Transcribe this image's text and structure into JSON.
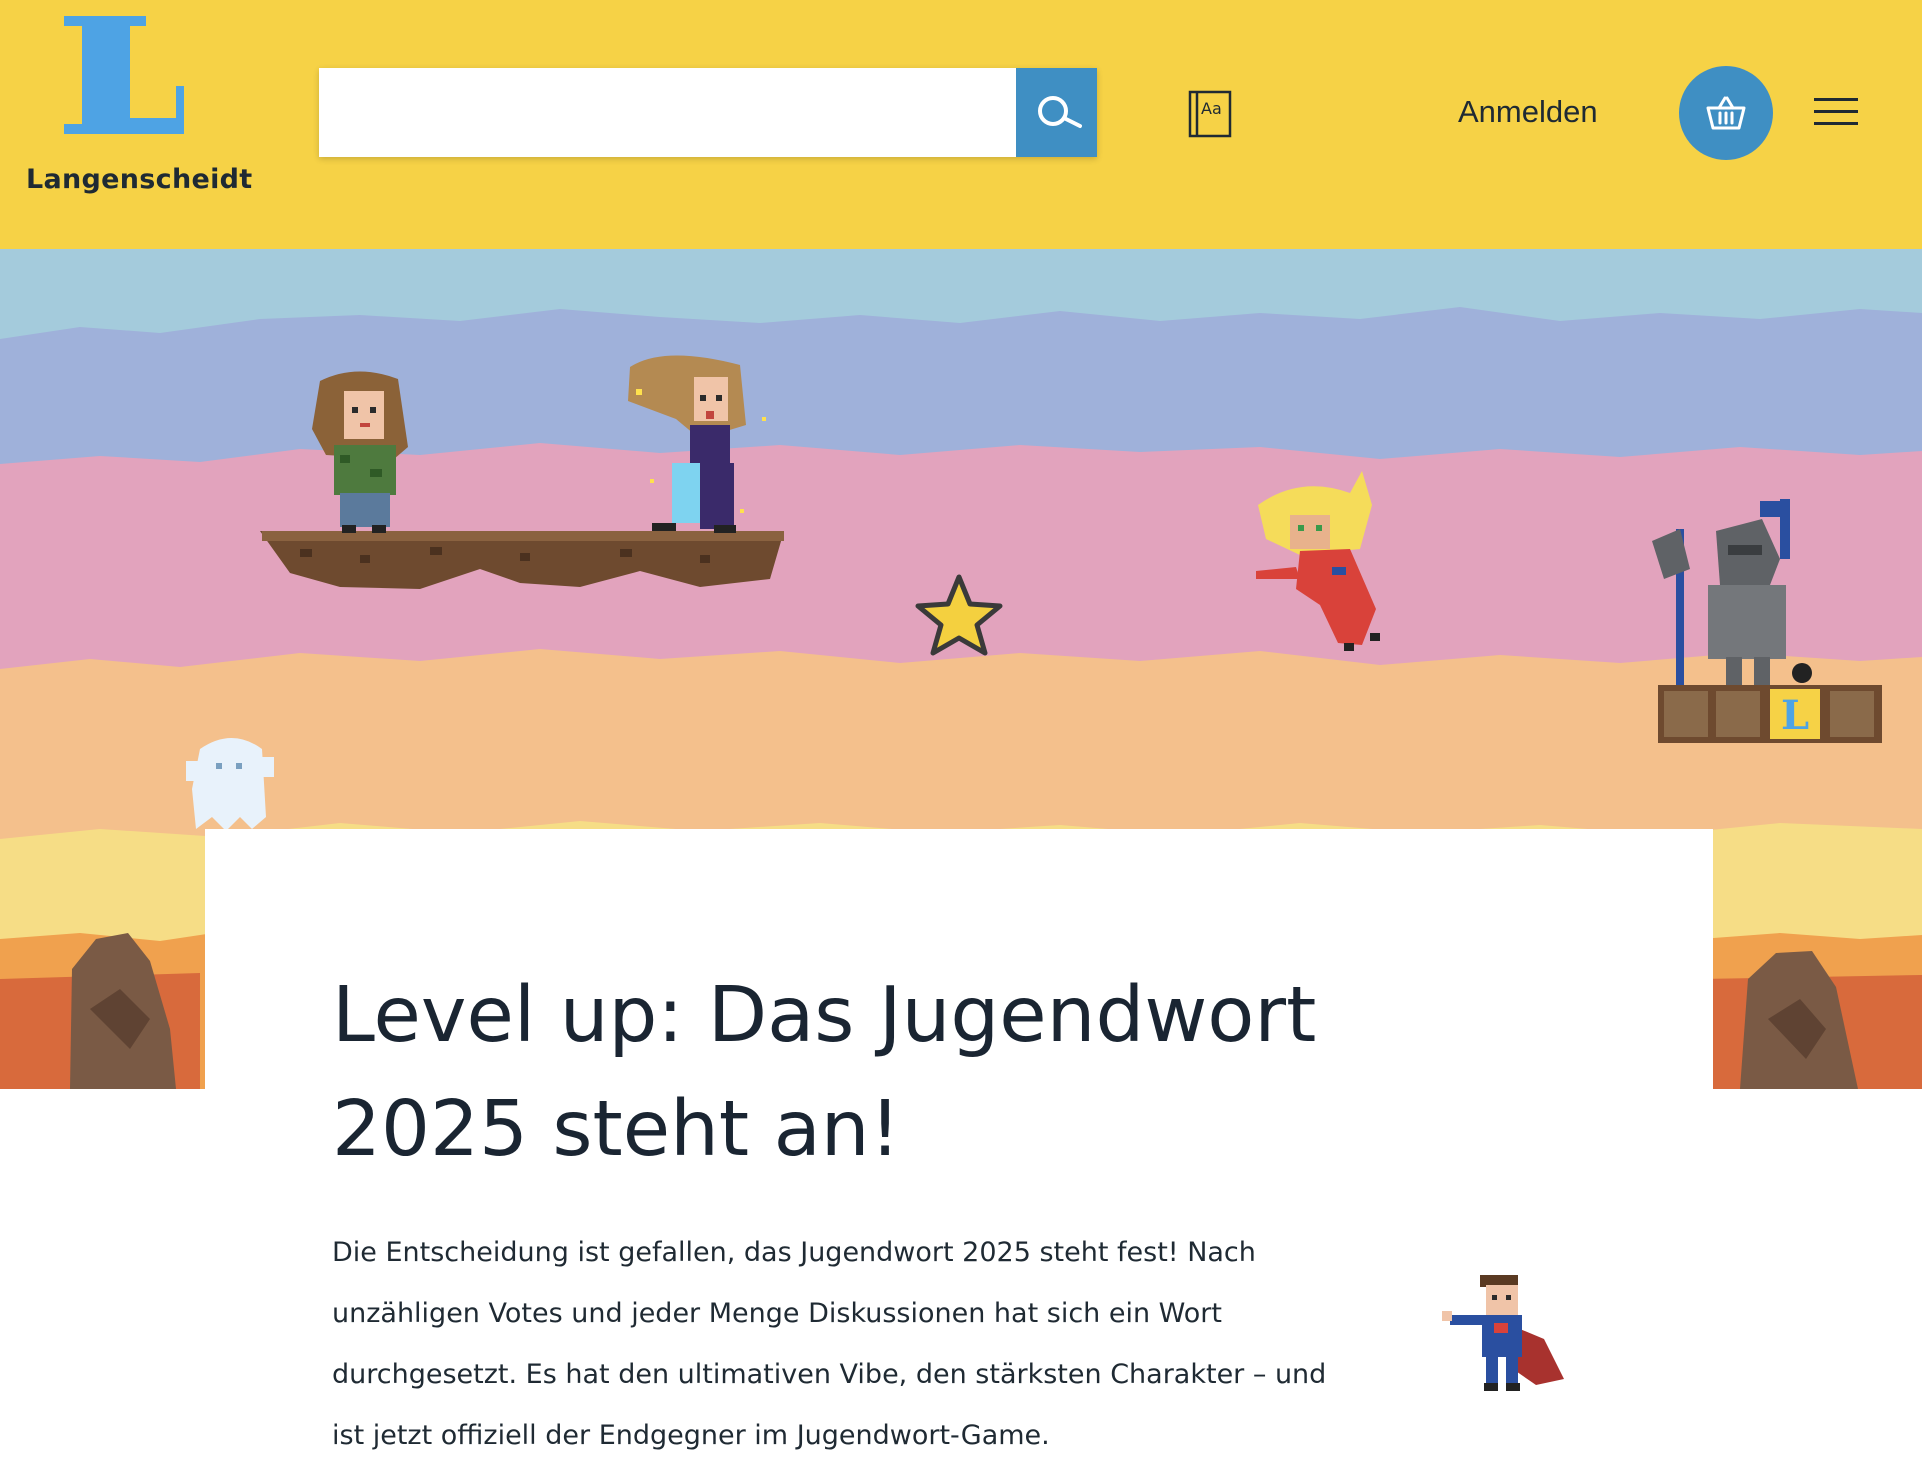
{
  "brand": {
    "name": "Langenscheidt",
    "accent_color": "#f6d246",
    "logo_color": "#4ea3e4",
    "button_color": "#3f8fc3"
  },
  "header": {
    "search": {
      "value": "",
      "placeholder": "",
      "button_icon": "search-icon"
    },
    "dictionary_icon": {
      "icon": "dictionary-icon",
      "label": "Aa"
    },
    "login_label": "Anmelden",
    "cart_icon": "basket-icon",
    "menu_icon": "hamburger-icon"
  },
  "hero": {
    "logo_block_label": "L",
    "characters": [
      "girl-character",
      "girl-dancing-character",
      "star",
      "viking-character",
      "knight-character",
      "ghost-character",
      "superhero-character"
    ]
  },
  "article": {
    "headline": "Level up: Das Jugendwort 2025 steht an!",
    "intro": "Die Entscheidung ist gefallen, das Jugendwort 2025 steht fest! Nach unzähligen Votes und jeder Menge Diskussionen hat sich ein Wort durchgesetzt. Es hat den ultimativen Vibe, den stärksten Charakter – und ist jetzt offiziell der Endgegner im Jugendwort-Game."
  }
}
